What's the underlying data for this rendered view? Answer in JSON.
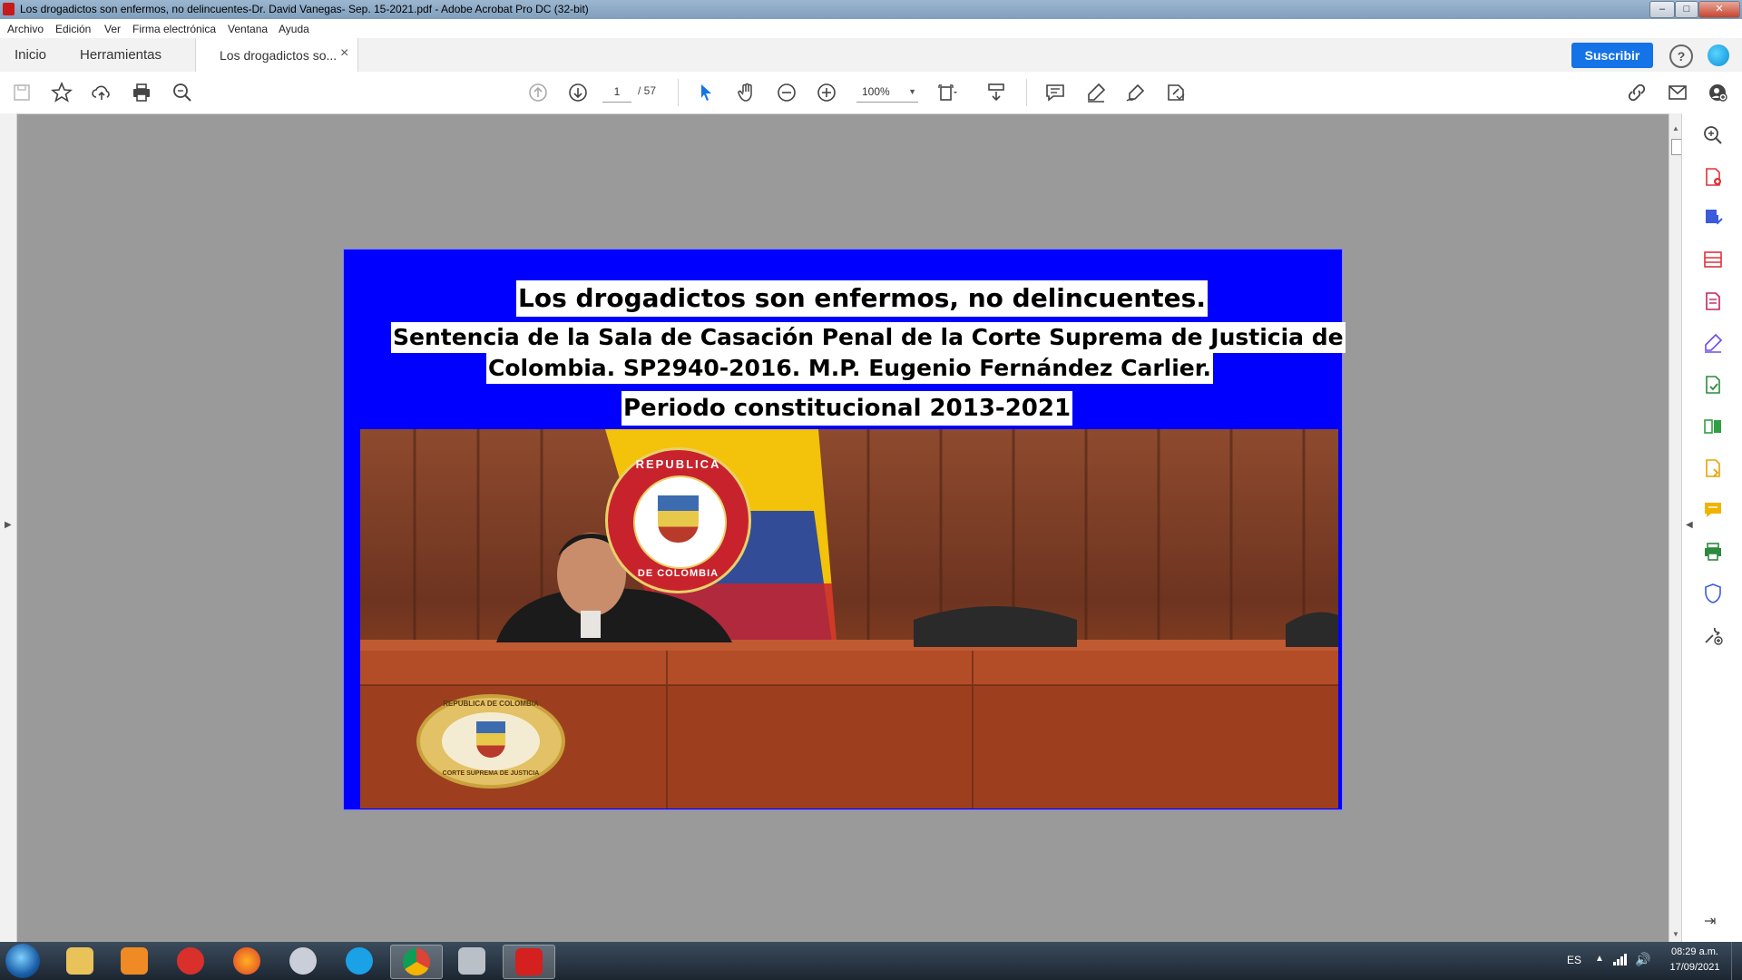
{
  "window": {
    "title": "Los drogadictos son enfermos, no delincuentes-Dr. David Vanegas- Sep. 15-2021.pdf - Adobe Acrobat Pro DC (32-bit)"
  },
  "menu": [
    "Archivo",
    "Edición",
    "Ver",
    "Firma electrónica",
    "Ventana",
    "Ayuda"
  ],
  "tabs": {
    "home": "Inicio",
    "tools": "Herramientas",
    "document": "Los drogadictos so...",
    "close": "×",
    "subscribe": "Suscribir"
  },
  "toolbar": {
    "page_current": "1",
    "page_total": "/ 57",
    "zoom": "100%"
  },
  "document": {
    "headline": "Los drogadictos son enfermos, no delincuentes.",
    "line2": "Sentencia de la Sala de Casación Penal de la Corte Suprema de Justicia de",
    "line3": "Colombia. SP2940-2016. M.P. Eugenio Fernández Carlier.",
    "line4": "Periodo constitucional 2013-2021",
    "seal_flag_text_top": "REPUBLICA",
    "seal_flag_text_bottom": "DE COLOMBIA",
    "seal_desk_text_top": "REPUBLICA DE COLOMBIA",
    "seal_desk_text_bottom": "CORTE SUPREMA DE JUSTICIA"
  },
  "taskbar": {
    "lang": "ES",
    "time": "08:29 a.m.",
    "date": "17/09/2021"
  },
  "colors": {
    "page_background": "#0000ff",
    "accent": "#1473e6"
  }
}
